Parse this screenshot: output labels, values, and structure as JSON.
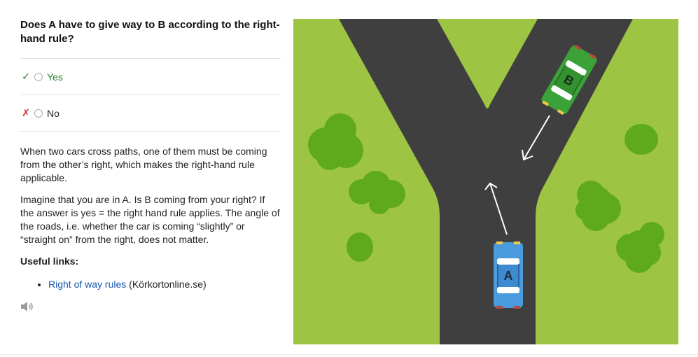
{
  "question": "Does A have to give way to B according to the right-hand rule?",
  "options": [
    {
      "label": "Yes",
      "mark": "✓"
    },
    {
      "label": "No",
      "mark": "✗"
    }
  ],
  "explanation": [
    "When two cars cross paths, one of them must be coming from the other’s right, which makes the right-hand rule applicable.",
    "Imagine that you are in A. Is B coming from your right? If the answer is yes = the right hand rule applies. The angle of the roads, i.e. whether the car is coming “slightly” or “straight on” from the right, does not matter."
  ],
  "useful_links": {
    "title": "Useful links:",
    "items": [
      {
        "link_text": "Right of way rules",
        "source": " (Körkortonline.se)"
      }
    ]
  },
  "illustration": {
    "car_a_label": "A",
    "car_b_label": "B"
  },
  "colors": {
    "grass": "#9ec443",
    "road": "#3f3f3f",
    "tree": "#5faa1c",
    "car_a": "#4a9ade",
    "car_b": "#3aa238",
    "correct": "#2e7d32",
    "wrong": "#d32f2f",
    "link": "#1a56b0"
  }
}
